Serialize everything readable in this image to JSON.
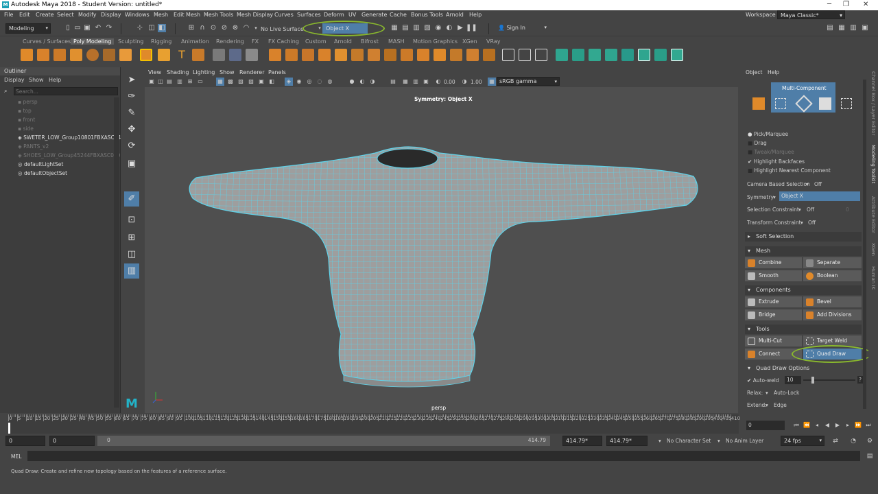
{
  "window": {
    "title": "Autodesk Maya 2018 - Student Version: untitled*",
    "min": "─",
    "max": "❐",
    "close": "✕"
  },
  "menus": [
    "File",
    "Edit",
    "Create",
    "Select",
    "Modify",
    "Display",
    "Windows",
    "Mesh",
    "Edit Mesh",
    "Mesh Tools",
    "Mesh Display",
    "Curves",
    "Surfaces",
    "Deform",
    "UV",
    "Generate",
    "Cache",
    "Bonus Tools",
    "Arnold",
    "Help"
  ],
  "workspace": {
    "label": "Workspace :",
    "value": "Maya Classic*"
  },
  "status": {
    "mode": "Modeling",
    "live_surface": "No Live Surface",
    "symmetry_field": "Object X",
    "sign_in": "Sign In"
  },
  "shelf_tabs": [
    "Curves / Surfaces",
    "Poly Modeling",
    "Sculpting",
    "Rigging",
    "Animation",
    "Rendering",
    "FX",
    "FX Caching",
    "Custom",
    "Arnold",
    "Bifrost",
    "MASH",
    "Motion Graphics",
    "XGen",
    "VRay"
  ],
  "shelf_active": "Poly Modeling",
  "outliner": {
    "title": "Outliner",
    "menu": [
      "Display",
      "Show",
      "Help"
    ],
    "search_placeholder": "Search...",
    "items": [
      {
        "label": "persp",
        "dim": true
      },
      {
        "label": "top",
        "dim": true
      },
      {
        "label": "front",
        "dim": true
      },
      {
        "label": "side",
        "dim": true
      },
      {
        "label": "SWETER_LOW_Group10801FBXASC04",
        "dim": false
      },
      {
        "label": "PANTS_v2",
        "dim": true
      },
      {
        "label": "SHOES_LOW_Group45244FBXASC040",
        "dim": true
      },
      {
        "label": "defaultLightSet",
        "dim": false
      },
      {
        "label": "defaultObjectSet",
        "dim": false
      }
    ]
  },
  "viewport": {
    "menu": [
      "View",
      "Shading",
      "Lighting",
      "Show",
      "Renderer",
      "Panels"
    ],
    "exposure": "0.00",
    "gamma": "1.00",
    "color_space": "sRGB gamma",
    "symmetry_label": "Symmetry: Object X",
    "camera": "persp"
  },
  "modeling_toolkit": {
    "menu": [
      "Object",
      "Help"
    ],
    "mode": "Multi-Component",
    "options": [
      {
        "label": "Pick/Marquee",
        "state": "radio-on"
      },
      {
        "label": "Drag",
        "state": "radio-off"
      },
      {
        "label": "Tweak/Marquee",
        "state": "radio-dim"
      },
      {
        "label": "Highlight Backfaces",
        "state": "check-on"
      },
      {
        "label": "Highlight Nearest Component",
        "state": "check-off"
      }
    ],
    "camera_based": {
      "label": "Camera Based Selection",
      "value": "Off"
    },
    "symmetry": {
      "label": "Symmetry",
      "value": "Object X"
    },
    "sel_constraint": {
      "label": "Selection Constraint",
      "value": "Off",
      "num": "0"
    },
    "transform_constraint": {
      "label": "Transform Constraint",
      "value": "Off"
    },
    "soft_selection": "Soft Selection",
    "mesh": {
      "title": "Mesh",
      "buttons": [
        "Combine",
        "Separate",
        "Smooth",
        "Boolean"
      ]
    },
    "components": {
      "title": "Components",
      "buttons": [
        "Extrude",
        "Bevel",
        "Bridge",
        "Add Divisions"
      ]
    },
    "tools": {
      "title": "Tools",
      "buttons": [
        "Multi-Cut",
        "Target Weld",
        "Connect",
        "Quad Draw"
      ]
    },
    "quad_draw_options": {
      "title": "Quad Draw Options",
      "auto_weld": "Auto-weld",
      "weld_value": "10",
      "help": "?",
      "relax_label": "Relax:",
      "relax_value": "Auto-Lock",
      "extend_label": "Extend:",
      "extend_value": "Edge"
    }
  },
  "side_tabs": [
    "Channel Box / Layer Editor",
    "Modeling Toolkit",
    "Attribute Editor",
    "XGen",
    "Human IK"
  ],
  "timeline": {
    "ticks": [
      "0",
      "5",
      "10",
      "15",
      "20",
      "25",
      "30",
      "35",
      "40",
      "45",
      "50",
      "55",
      "60",
      "65",
      "70",
      "75",
      "80",
      "85",
      "90",
      "95",
      "100",
      "105",
      "110",
      "115",
      "120",
      "125",
      "130",
      "135",
      "140",
      "145",
      "150",
      "155",
      "160",
      "165",
      "170",
      "175",
      "180",
      "185",
      "190",
      "195",
      "200",
      "205",
      "210",
      "215",
      "220",
      "225",
      "230",
      "235",
      "240",
      "245",
      "250",
      "255",
      "260",
      "265",
      "270",
      "275",
      "280",
      "285",
      "290",
      "295",
      "300",
      "305",
      "310",
      "315",
      "320",
      "325",
      "330",
      "335",
      "340",
      "345",
      "350",
      "355",
      "360",
      "365",
      "370",
      "375",
      "380",
      "385",
      "390",
      "395",
      "400",
      "405",
      "410"
    ],
    "current": "0"
  },
  "range": {
    "start": "0",
    "inner_start": "0",
    "slider_start": "0",
    "slider_end": "414.79",
    "end": "414.79*",
    "end2": "414.79*",
    "char_set": "No Character Set",
    "anim_layer": "No Anim Layer",
    "fps": "24 fps"
  },
  "command": {
    "lang": "MEL"
  },
  "help_line": "Quad Draw: Create and refine new topology based on the features of a reference surface.",
  "accent": "#4f7ea8",
  "highlight_ring": "#8ab92d",
  "wire_color": "#5fd3ea"
}
